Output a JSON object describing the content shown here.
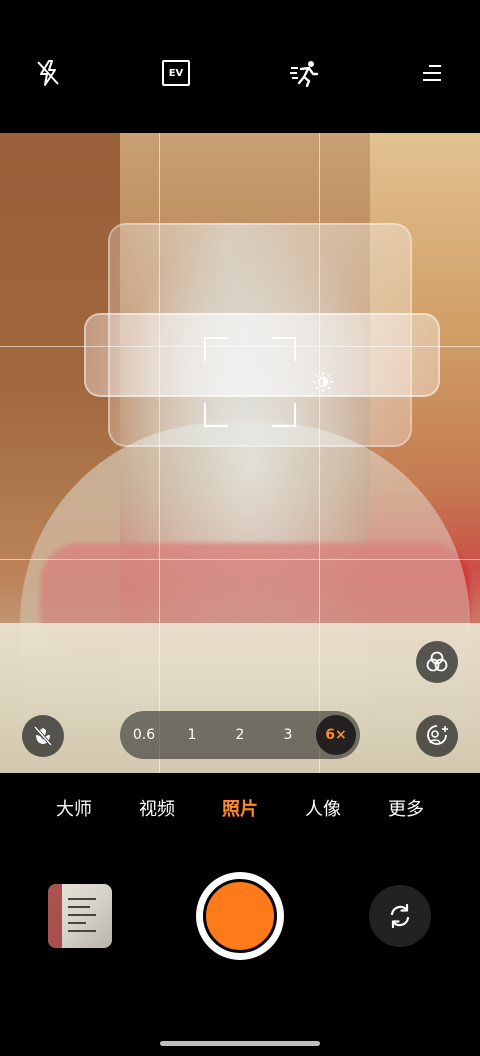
{
  "top_bar": {
    "flash_icon": "flash-off-icon",
    "ev_label": "EV",
    "motion_icon": "motion-capture-icon",
    "menu_icon": "menu-icon"
  },
  "viewfinder": {
    "grid": true,
    "focus_frame": "focus-frame",
    "exposure_icon": "sun-icon"
  },
  "zoom": {
    "options": [
      "0.6",
      "1",
      "2",
      "3",
      "6×"
    ],
    "selected": "6×"
  },
  "side_buttons": {
    "filters_icon": "filters-icon",
    "macro_icon": "macro-off-icon",
    "portrait_icon": "portrait-effect-icon"
  },
  "modes": {
    "items": [
      "大师",
      "视频",
      "照片",
      "人像",
      "更多"
    ],
    "active": "照片"
  },
  "bottom": {
    "gallery_icon": "gallery-thumbnail",
    "shutter_icon": "shutter-button",
    "switch_icon": "switch-camera-icon"
  },
  "colors": {
    "accent": "#ff8a2b",
    "shutter": "#ff7a1a"
  }
}
